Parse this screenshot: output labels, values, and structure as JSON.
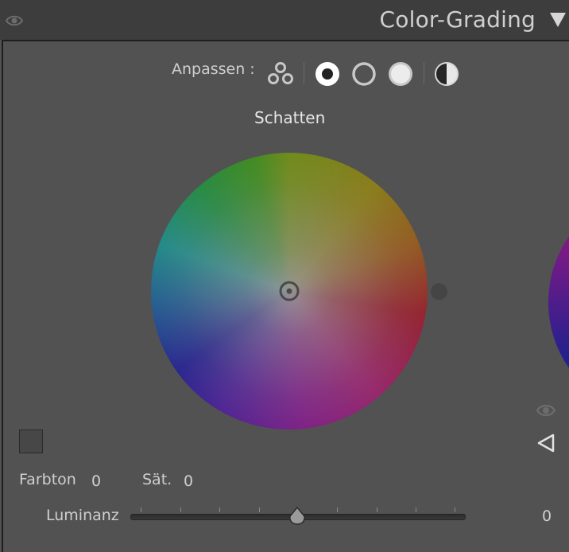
{
  "header": {
    "title": "Color-Grading",
    "visibility_icon": "eye-icon",
    "collapse_icon": "triangle-down-icon"
  },
  "adjust": {
    "label": "Anpassen :",
    "modes": [
      {
        "name": "three-way",
        "icon": "three-circles-icon"
      },
      {
        "name": "shadows",
        "icon": "filled-dot-circle-icon",
        "selected": true
      },
      {
        "name": "midtones",
        "icon": "ring-icon"
      },
      {
        "name": "highlights",
        "icon": "light-circle-icon"
      },
      {
        "name": "global",
        "icon": "half-circle-icon"
      }
    ]
  },
  "wheel": {
    "label": "Schatten"
  },
  "values": {
    "hue_label": "Farbton",
    "hue_value": "0",
    "sat_label": "Sät.",
    "sat_value": "0",
    "lum_label": "Luminanz",
    "lum_value": "0"
  },
  "slider": {
    "luminance_level": 0.5
  },
  "colors": {
    "panel_bg": "#525252",
    "header_bg": "#3d3d3d",
    "text": "#cfcfcf"
  }
}
